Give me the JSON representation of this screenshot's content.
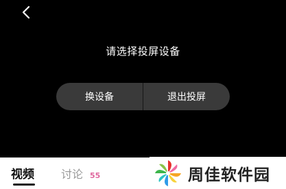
{
  "player": {
    "back_icon": "chevron-left-icon",
    "cast_prompt": "请选择投屏设备",
    "switch_device_label": "换设备",
    "exit_cast_label": "退出投屏"
  },
  "tabs": {
    "video_label": "视频",
    "comments_label": "讨论",
    "comments_count": "55"
  },
  "watermark": {
    "text": "周佳软件园"
  },
  "colors": {
    "player_background": "#000000",
    "button_background": "#3a3a3a",
    "comment_count": "#e0679e"
  }
}
